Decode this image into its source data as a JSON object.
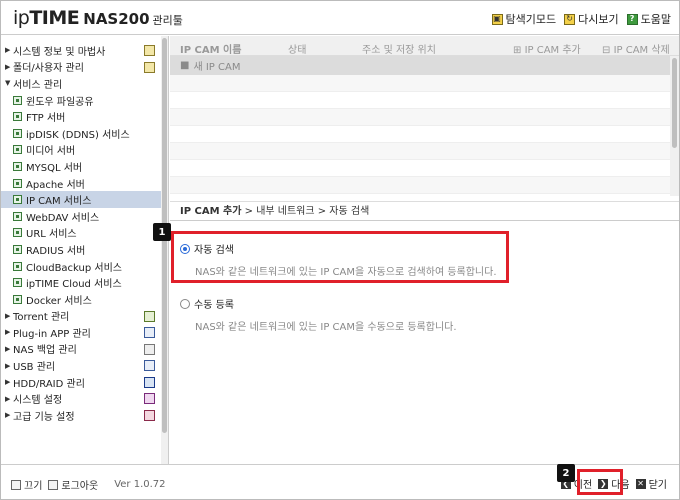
{
  "header": {
    "logo_ip": "ip",
    "logo_time": "TIME",
    "logo_model": "NAS200",
    "logo_suffix": "관리툴",
    "links": [
      {
        "label": "탐색기모드",
        "icon": "explorer-icon"
      },
      {
        "label": "다시보기",
        "icon": "refresh-icon"
      },
      {
        "label": "도움말",
        "icon": "help-icon"
      }
    ]
  },
  "sidebar": {
    "items": [
      {
        "label": "시스템 정보 및 마법사",
        "level": "top",
        "arrow": "▶",
        "icon": "chart-icon"
      },
      {
        "label": "폴더/사용자 관리",
        "level": "top",
        "arrow": "▶",
        "icon": "folder-icon"
      },
      {
        "label": "서비스 관리",
        "level": "top",
        "arrow": "▼",
        "icon": ""
      },
      {
        "label": "윈도우 파일공유",
        "level": "child"
      },
      {
        "label": "FTP 서버",
        "level": "child"
      },
      {
        "label": "ipDISK (DDNS) 서비스",
        "level": "child"
      },
      {
        "label": "미디어 서버",
        "level": "child"
      },
      {
        "label": "MYSQL 서버",
        "level": "child"
      },
      {
        "label": "Apache 서버",
        "level": "child"
      },
      {
        "label": "IP CAM 서비스",
        "level": "child",
        "selected": true
      },
      {
        "label": "WebDAV 서비스",
        "level": "child"
      },
      {
        "label": "URL 서비스",
        "level": "child"
      },
      {
        "label": "RADIUS 서버",
        "level": "child"
      },
      {
        "label": "CloudBackup 서비스",
        "level": "child"
      },
      {
        "label": "ipTIME Cloud 서비스",
        "level": "child"
      },
      {
        "label": "Docker 서비스",
        "level": "child"
      },
      {
        "label": "Torrent 관리",
        "level": "top",
        "arrow": "▶",
        "icon": "torrent-icon"
      },
      {
        "label": "Plug-in APP 관리",
        "level": "top",
        "arrow": "▶",
        "icon": "plugin-icon"
      },
      {
        "label": "NAS 백업 관리",
        "level": "top",
        "arrow": "▶",
        "icon": "backup-icon"
      },
      {
        "label": "USB 관리",
        "level": "top",
        "arrow": "▶",
        "icon": "usb-icon"
      },
      {
        "label": "HDD/RAID 관리",
        "level": "top",
        "arrow": "▶",
        "icon": "hdd-icon"
      },
      {
        "label": "시스템 설정",
        "level": "top",
        "arrow": "▶",
        "icon": "settings-icon"
      },
      {
        "label": "고급 기능 설정",
        "level": "top",
        "arrow": "▶",
        "icon": "advanced-icon"
      }
    ]
  },
  "list": {
    "columns": [
      "IP CAM 이름",
      "상태",
      "주소 및 저장 위치",
      "IP CAM 추가",
      "IP CAM 삭제"
    ],
    "new_row": "새 IP CAM"
  },
  "breadcrumb": {
    "bold": "IP CAM 추가",
    "rest": " > 내부 네트워크 > 자동 검색"
  },
  "options": {
    "auto": {
      "label": "자동 검색",
      "desc": "NAS와 같은 네트워크에 있는 IP CAM을 자동으로 검색하여 등록합니다."
    },
    "manual": {
      "label": "수동 등록",
      "desc": "NAS와 같은 네트워크에 있는 IP CAM을 수동으로 등록합니다."
    }
  },
  "callouts": {
    "one": "1",
    "two": "2"
  },
  "footer": {
    "power_off": "끄기",
    "logout": "로그아웃",
    "version": "Ver 1.0.72",
    "prev": "이전",
    "next": "다음",
    "close": "닫기"
  }
}
